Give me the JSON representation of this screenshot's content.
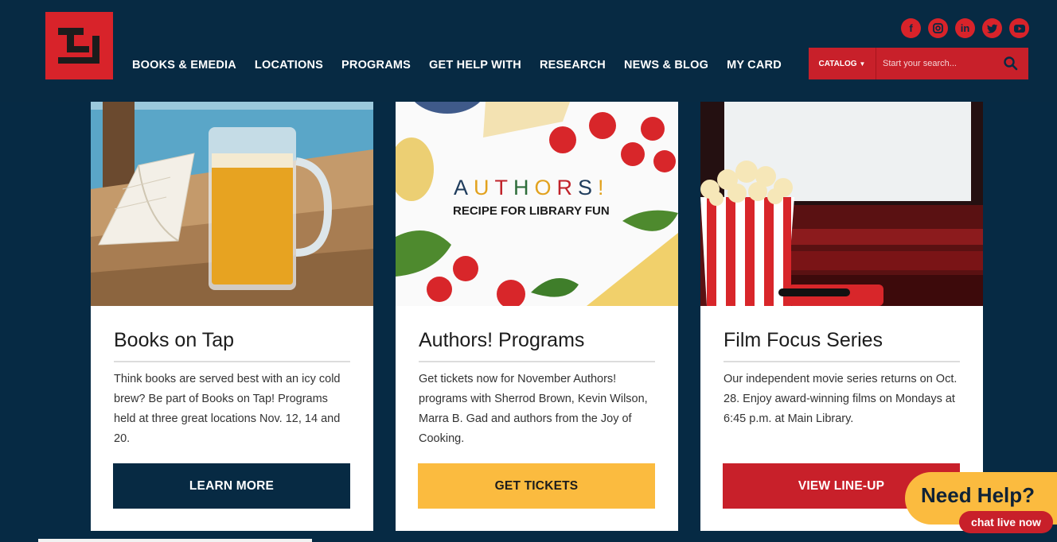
{
  "nav": {
    "items": [
      {
        "label": "BOOKS & EMEDIA"
      },
      {
        "label": "LOCATIONS"
      },
      {
        "label": "PROGRAMS"
      },
      {
        "label": "GET HELP WITH"
      },
      {
        "label": "RESEARCH"
      },
      {
        "label": "NEWS & BLOG"
      },
      {
        "label": "MY CARD"
      }
    ]
  },
  "social": [
    "facebook-icon",
    "instagram-icon",
    "linkedin-icon",
    "twitter-icon",
    "youtube-icon"
  ],
  "search": {
    "catalog_label": "CATALOG",
    "placeholder": "Start your search..."
  },
  "cards": [
    {
      "title": "Books on Tap",
      "text": "Think books are served best with an icy cold brew? Be part of Books on Tap! Programs held at three great locations Nov. 12, 14 and 20.",
      "button": "LEARN MORE"
    },
    {
      "title": "Authors! Programs",
      "text": "Get tickets now for November Authors! programs with Sherrod Brown, Kevin Wilson, Marra B. Gad and authors from the Joy of Cooking.",
      "button": "GET TICKETS",
      "image_heading": "AUTHORS!",
      "image_subheading": "RECIPE FOR LIBRARY FUN"
    },
    {
      "title": "Film Focus Series",
      "text": "Our independent movie series returns on Oct. 28. Enjoy award-winning films on Mondays at 6:45 p.m. at Main Library.",
      "button": "VIEW LINE-UP"
    }
  ],
  "help": {
    "heading": "Need Help?",
    "chat": "chat live now"
  },
  "colors": {
    "navy": "#072a43",
    "red": "#c8202a",
    "yellow": "#fbbb3f"
  }
}
